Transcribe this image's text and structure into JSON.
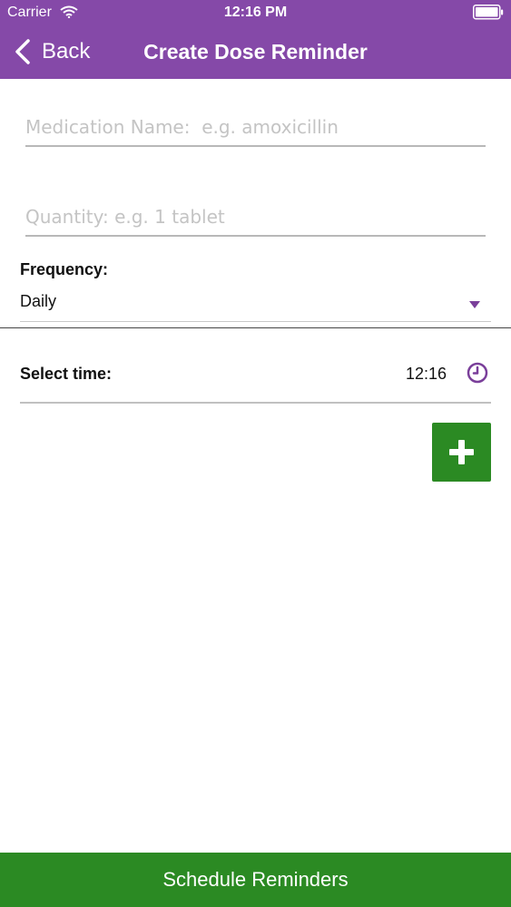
{
  "status_bar": {
    "carrier": "Carrier",
    "time": "12:16 PM"
  },
  "nav": {
    "back_label": "Back",
    "title": "Create Dose Reminder"
  },
  "form": {
    "medication_placeholder": "Medication Name:  e.g. amoxicillin",
    "medication_value": "",
    "quantity_placeholder": "Quantity: e.g. 1 tablet",
    "quantity_value": "",
    "frequency_label": "Frequency:",
    "frequency_value": "Daily",
    "time_label": "Select time:",
    "time_value": "12:16"
  },
  "schedule_button_label": "Schedule Reminders",
  "colors": {
    "nav_bar": "#8549a8",
    "accent_purple": "#7a3f9a",
    "action_green": "#2b8a23"
  },
  "icons": {
    "wifi": "wifi-icon",
    "battery": "battery-icon",
    "back": "chevron-left-icon",
    "dropdown": "caret-down-icon",
    "clock": "clock-icon",
    "add": "plus-icon"
  }
}
